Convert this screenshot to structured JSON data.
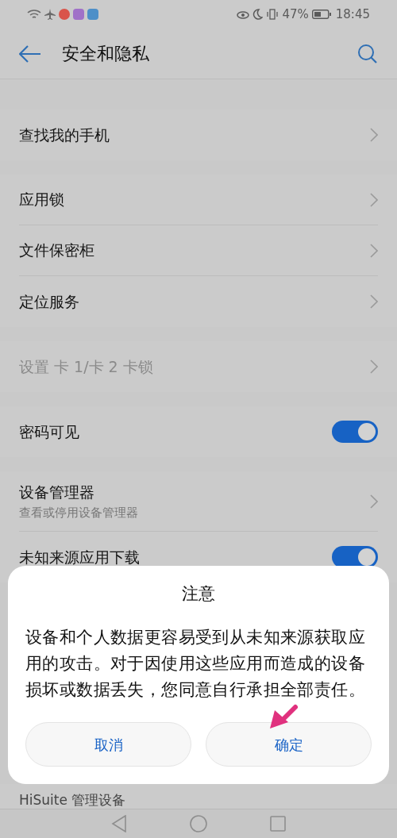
{
  "status_bar": {
    "battery": "47%",
    "time": "18:45"
  },
  "header": {
    "title": "安全和隐私"
  },
  "groups": [
    [
      {
        "kind": "link",
        "label": "查找我的手机",
        "disabled": false
      }
    ],
    [
      {
        "kind": "link",
        "label": "应用锁",
        "disabled": false
      },
      {
        "kind": "link",
        "label": "文件保密柜",
        "disabled": false
      },
      {
        "kind": "link",
        "label": "定位服务",
        "disabled": false
      }
    ],
    [
      {
        "kind": "link",
        "label": "设置 卡 1/卡 2 卡锁",
        "disabled": true
      }
    ],
    [
      {
        "kind": "toggle",
        "label": "密码可见",
        "disabled": false,
        "on": true
      }
    ],
    [
      {
        "kind": "link",
        "label": "设备管理器",
        "subtitle": "查看或停用设备管理器",
        "disabled": false
      },
      {
        "kind": "toggle",
        "label": "未知来源应用下载",
        "disabled": false,
        "on": true
      }
    ]
  ],
  "dialog": {
    "title": "注意",
    "message": "设备和个人数据更容易受到从未知来源获取应用的攻击。对于因使用这些应用而造成的设备损坏或数据丢失，您同意自行承担全部责任。",
    "buttons": [
      {
        "label": "取消"
      },
      {
        "label": "确定"
      }
    ]
  },
  "bottom_item": {
    "label": "HiSuite 管理设备"
  }
}
